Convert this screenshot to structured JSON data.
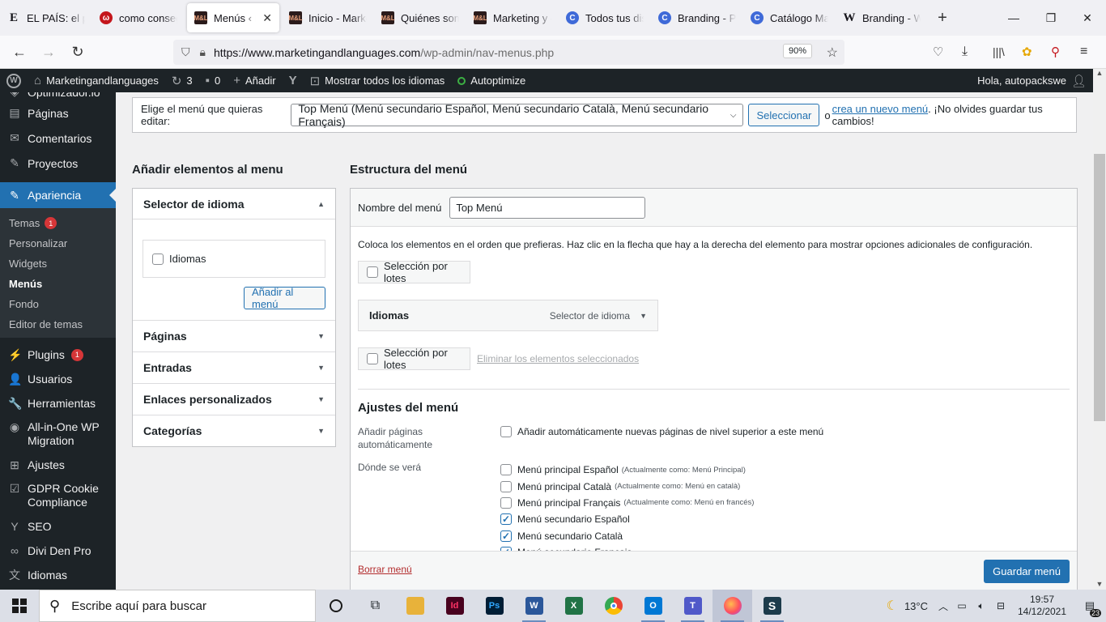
{
  "browser": {
    "tabs": [
      {
        "label": "EL PAÍS: el periódico",
        "icon": "el-pais-icon",
        "fav": "E",
        "cls": "e"
      },
      {
        "label": "como conseguir",
        "icon": "pinterest-icon",
        "fav": "ω",
        "cls": "red"
      },
      {
        "label": "Menús ‹ Marketing",
        "icon": "site-logo-icon",
        "fav": "M&L",
        "cls": "dark",
        "active": true
      },
      {
        "label": "Inicio - Marketing",
        "icon": "site-logo-icon",
        "fav": "M&L",
        "cls": "dark"
      },
      {
        "label": "Quiénes somos",
        "icon": "site-logo-icon",
        "fav": "M&L",
        "cls": "dark"
      },
      {
        "label": "Marketing y comunicación",
        "icon": "site-logo-icon",
        "fav": "M&L",
        "cls": "dark"
      },
      {
        "label": "Todos tus diseños",
        "icon": "canva-icon",
        "fav": "C",
        "cls": "blue"
      },
      {
        "label": "Branding - Presentación",
        "icon": "canva-icon",
        "fav": "C",
        "cls": "blue"
      },
      {
        "label": "Catálogo Marketing",
        "icon": "canva-icon",
        "fav": "C",
        "cls": "blue"
      },
      {
        "label": "Branding - Wikipedia",
        "icon": "wikipedia-icon",
        "fav": "W",
        "cls": "w"
      }
    ],
    "url_host": "https://www.marketingandlanguages.com",
    "url_path": "/wp-admin/nav-menus.php",
    "zoom": "90%"
  },
  "adminbar": {
    "site": "Marketingandlanguages",
    "updates": "3",
    "comments": "0",
    "add": "Añadir",
    "languages": "Mostrar todos los idiomas",
    "autoptimize": "Autoptimize",
    "greeting": "Hola, autopackswe"
  },
  "sidebar": {
    "top_cut": "Optimizador.io",
    "items_a": [
      {
        "label": "Páginas",
        "icon": "pages-icon",
        "g": "▤"
      },
      {
        "label": "Comentarios",
        "icon": "comments-icon",
        "g": "✉"
      },
      {
        "label": "Proyectos",
        "icon": "pin-icon",
        "g": "✎"
      }
    ],
    "active": "Apariencia",
    "sub": [
      {
        "label": "Temas",
        "badge": "1"
      },
      {
        "label": "Personalizar"
      },
      {
        "label": "Widgets"
      },
      {
        "label": "Menús",
        "cur": true
      },
      {
        "label": "Fondo"
      },
      {
        "label": "Editor de temas"
      }
    ],
    "items_b": [
      {
        "label": "Plugins",
        "icon": "plugins-icon",
        "g": "⚡",
        "badge": "1"
      },
      {
        "label": "Usuarios",
        "icon": "users-icon",
        "g": "👤"
      },
      {
        "label": "Herramientas",
        "icon": "tools-icon",
        "g": "🔧"
      },
      {
        "label": "All-in-One WP Migration",
        "icon": "migration-icon",
        "g": "◉",
        "tall": true
      },
      {
        "label": "Ajustes",
        "icon": "settings-icon",
        "g": "⊞"
      },
      {
        "label": "GDPR Cookie Compliance",
        "icon": "gdpr-icon",
        "g": "☑",
        "tall": true
      },
      {
        "label": "SEO",
        "icon": "yoast-icon",
        "g": "Y"
      },
      {
        "label": "Divi Den Pro",
        "icon": "divi-den-icon",
        "g": "∞"
      },
      {
        "label": "Idiomas",
        "icon": "languages-icon",
        "g": "文"
      }
    ]
  },
  "menu_select": {
    "prompt": "Elige el menú que quieras editar:",
    "selected": "Top Menú (Menú secundario Español, Menú secundario Català, Menú secundario Français)",
    "select_btn": "Seleccionar",
    "or": "o",
    "create_link": "crea un nuevo menú",
    "reminder": ". ¡No olvides guardar tus cambios!"
  },
  "add_items": {
    "title": "Añadir elementos al menu",
    "lang_section": "Selector de idioma",
    "lang_checkbox": "Idiomas",
    "add_btn": "Añadir al menú",
    "sections": [
      "Páginas",
      "Entradas",
      "Enlaces personalizados",
      "Categorías"
    ]
  },
  "structure": {
    "title": "Estructura del menú",
    "name_label": "Nombre del menú",
    "name_value": "Top Menú",
    "instructions": "Coloca los elementos en el orden que prefieras. Haz clic en la flecha que hay a la derecha del elemento para mostrar opciones adicionales de configuración.",
    "bulk": "Selección por lotes",
    "item_title": "Idiomas",
    "item_type": "Selector de idioma",
    "bulk2": "Selección por lotes",
    "remove_selected": "Eliminar los elementos seleccionados",
    "settings_title": "Ajustes del menú",
    "auto_add_label": "Añadir páginas automáticamente",
    "auto_add_text": "Añadir automáticamente nuevas páginas de nivel superior a este menú",
    "where_label": "Dónde se verá",
    "locations": [
      {
        "name": "Menú principal Español",
        "note": "(Actualmente como: Menú Principal)",
        "checked": false
      },
      {
        "name": "Menú principal Català",
        "note": "(Actualmente como: Menú en català)",
        "checked": false
      },
      {
        "name": "Menú principal Français",
        "note": "(Actualmente como: Menú en francés)",
        "checked": false
      },
      {
        "name": "Menú secundario Español",
        "note": "",
        "checked": true
      },
      {
        "name": "Menú secundario Català",
        "note": "",
        "checked": true
      },
      {
        "name": "Menú secundario Français",
        "note": "",
        "checked": true
      }
    ],
    "delete": "Borrar menú",
    "save": "Guardar menú"
  },
  "taskbar": {
    "search": "Escribe aquí para buscar",
    "temp": "13°C",
    "time": "19:57",
    "date": "14/12/2021",
    "notif": "23"
  }
}
